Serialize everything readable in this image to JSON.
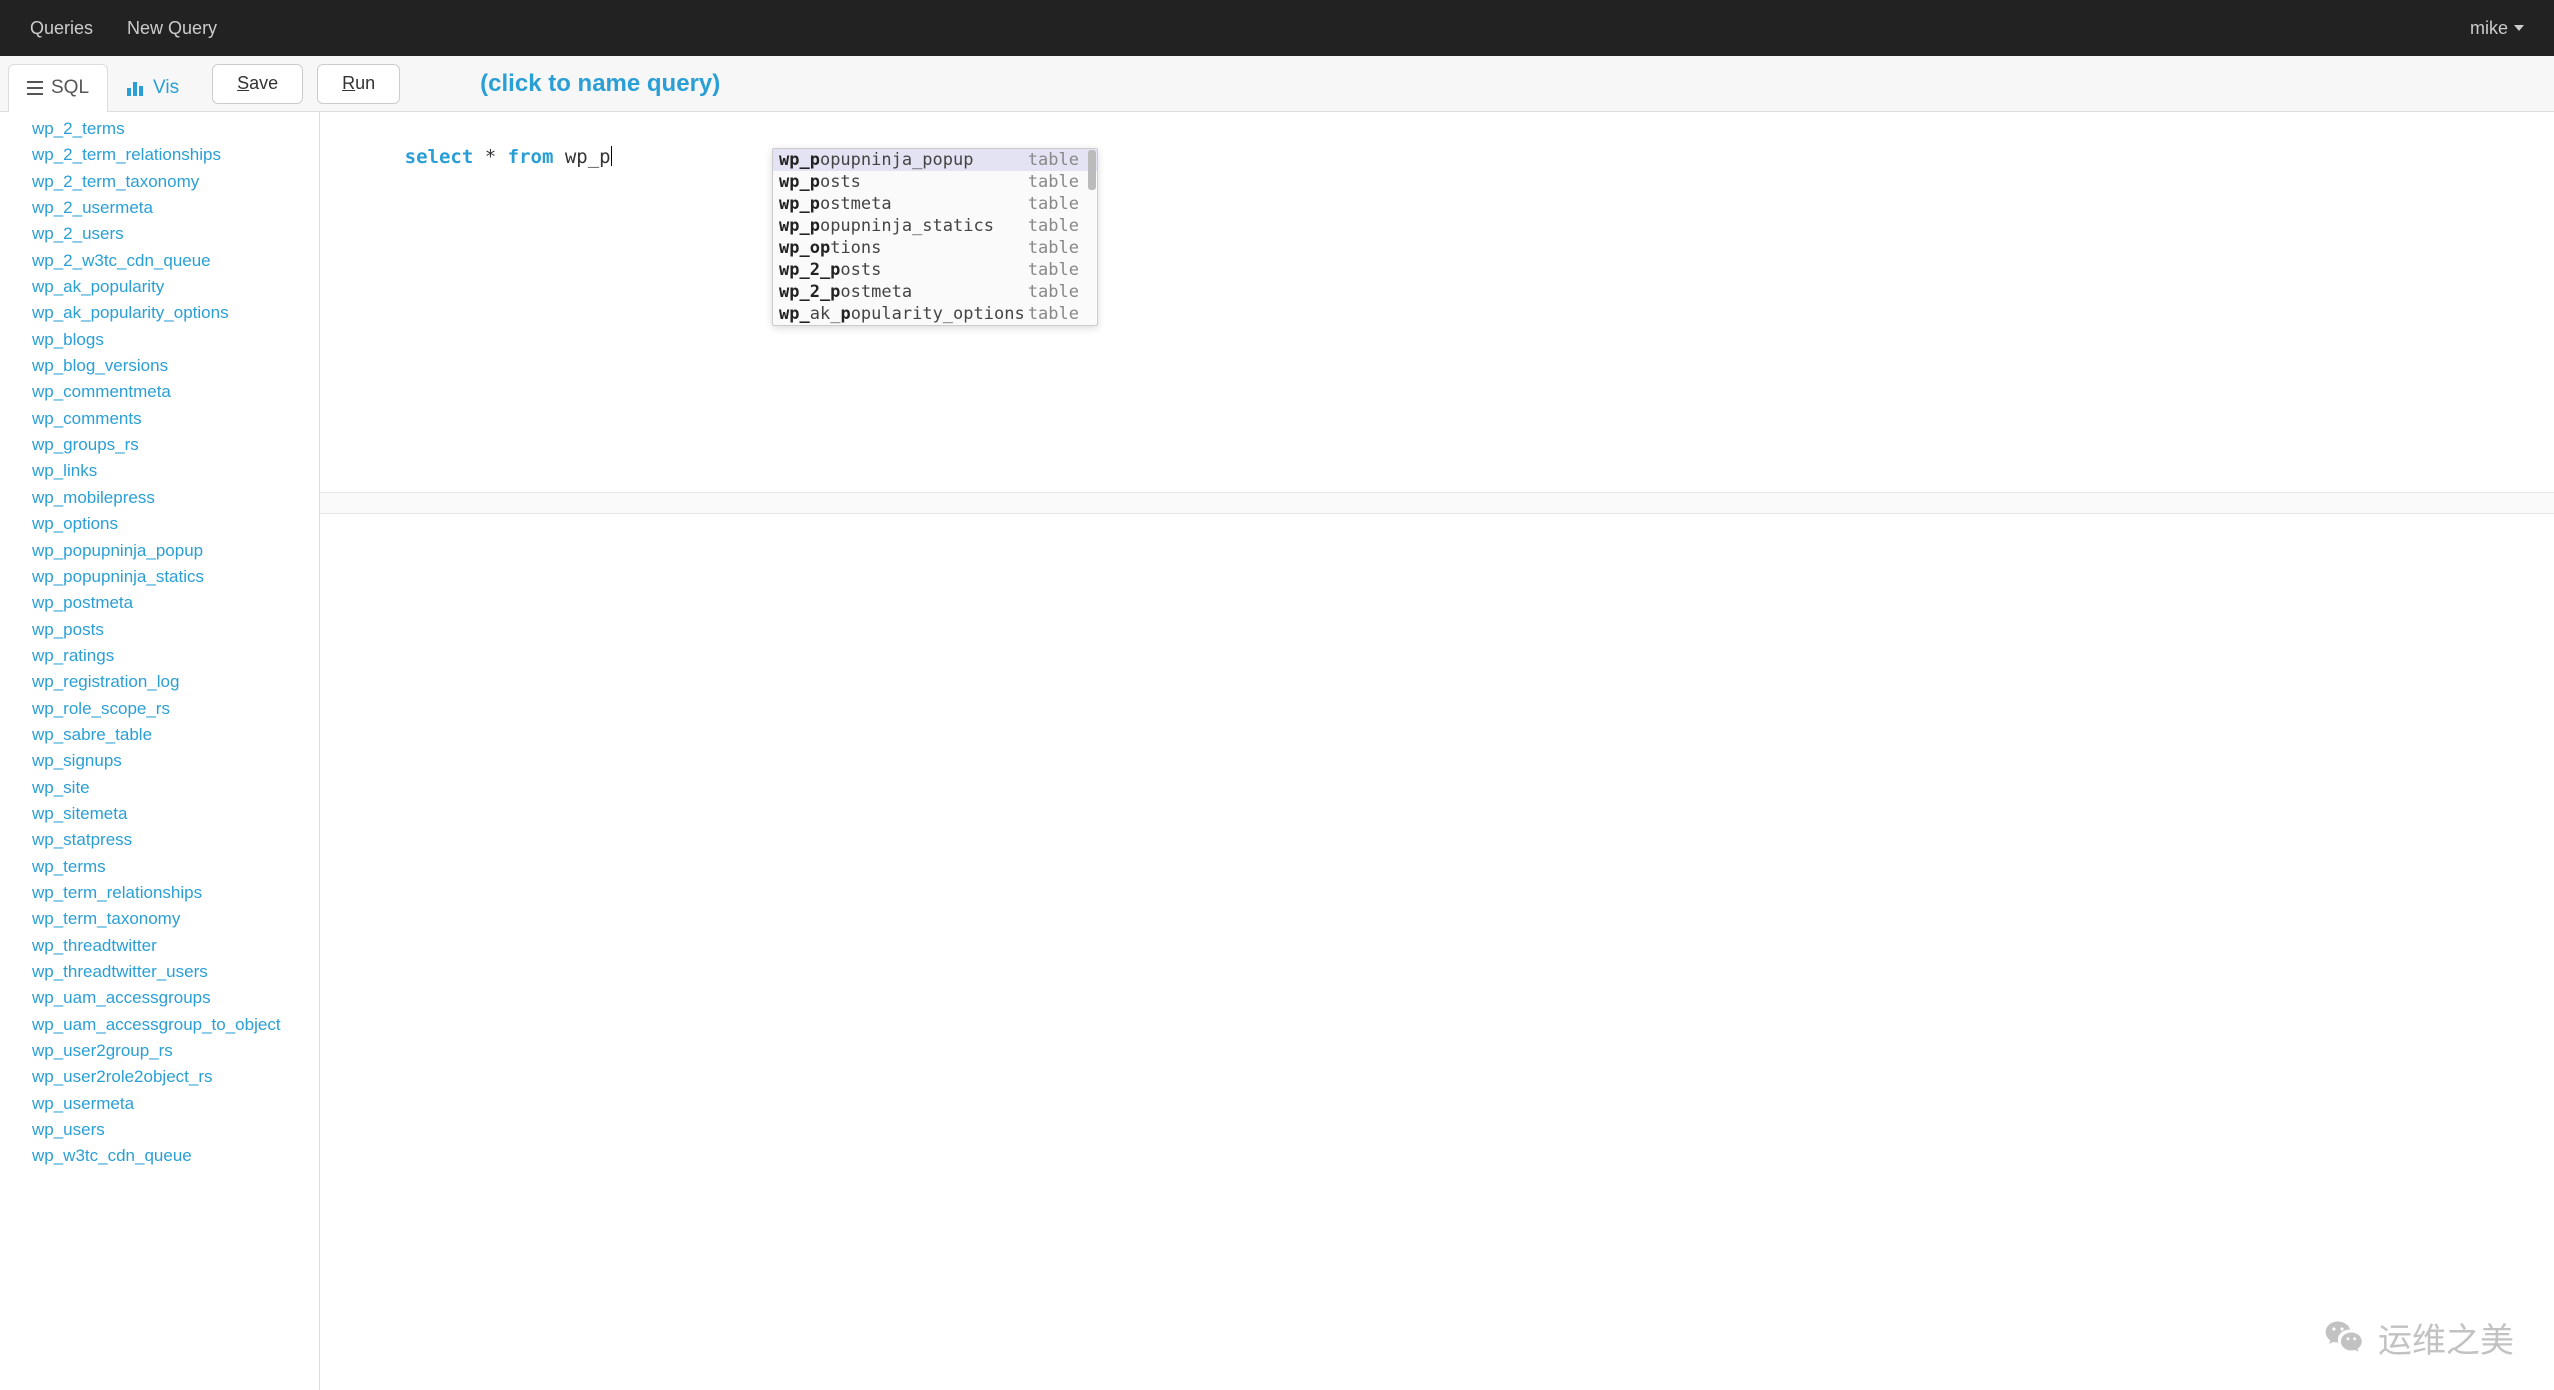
{
  "nav": {
    "queries": "Queries",
    "new_query": "New Query",
    "user": "mike"
  },
  "toolbar": {
    "tab_sql": "SQL",
    "tab_vis": "Vis",
    "save": "Save",
    "save_underline": "S",
    "run": "Run",
    "run_underline": "R",
    "query_name_placeholder": "(click to name query)"
  },
  "sql": {
    "keyword_select": "select",
    "star": "*",
    "keyword_from": "from",
    "typed": "wp_p"
  },
  "autocomplete": {
    "items": [
      {
        "prefix": "wp_p",
        "rest": "opupninja_popup",
        "type": "table",
        "selected": true
      },
      {
        "prefix": "wp_p",
        "rest": "osts",
        "type": "table",
        "selected": false
      },
      {
        "prefix": "wp_p",
        "rest": "ostmeta",
        "type": "table",
        "selected": false
      },
      {
        "prefix": "wp_p",
        "rest": "opupninja_statics",
        "type": "table",
        "selected": false
      },
      {
        "prefix": "wp_o",
        "rest": "",
        "mid": "p",
        "tail": "tions",
        "type": "table",
        "selected": false
      },
      {
        "prefix": "wp_2_p",
        "rest": "osts",
        "type": "table",
        "selected": false
      },
      {
        "prefix": "wp_2_p",
        "rest": "ostmeta",
        "type": "table",
        "selected": false
      },
      {
        "prefix": "wp_",
        "rest": "ak_",
        "mid": "p",
        "tail": "opularity_options",
        "type": "table",
        "selected": false
      }
    ]
  },
  "tables": [
    "wp_2_terms",
    "wp_2_term_relationships",
    "wp_2_term_taxonomy",
    "wp_2_usermeta",
    "wp_2_users",
    "wp_2_w3tc_cdn_queue",
    "wp_ak_popularity",
    "wp_ak_popularity_options",
    "wp_blogs",
    "wp_blog_versions",
    "wp_commentmeta",
    "wp_comments",
    "wp_groups_rs",
    "wp_links",
    "wp_mobilepress",
    "wp_options",
    "wp_popupninja_popup",
    "wp_popupninja_statics",
    "wp_postmeta",
    "wp_posts",
    "wp_ratings",
    "wp_registration_log",
    "wp_role_scope_rs",
    "wp_sabre_table",
    "wp_signups",
    "wp_site",
    "wp_sitemeta",
    "wp_statpress",
    "wp_terms",
    "wp_term_relationships",
    "wp_term_taxonomy",
    "wp_threadtwitter",
    "wp_threadtwitter_users",
    "wp_uam_accessgroups",
    "wp_uam_accessgroup_to_object",
    "wp_user2group_rs",
    "wp_user2role2object_rs",
    "wp_usermeta",
    "wp_users",
    "wp_w3tc_cdn_queue"
  ],
  "watermark": "运维之美"
}
